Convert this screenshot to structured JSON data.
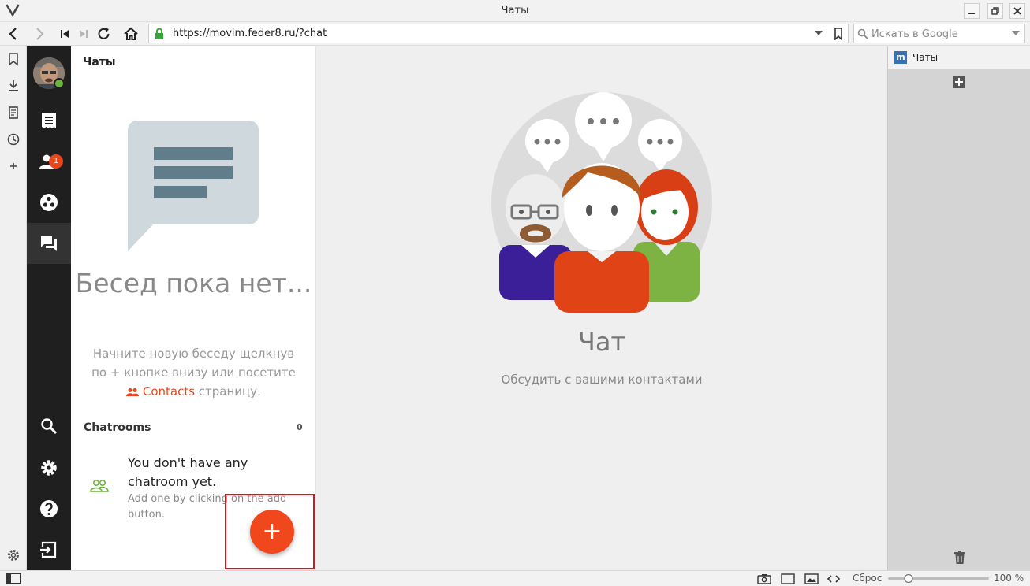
{
  "window": {
    "title": "Чаты"
  },
  "browser": {
    "url": "https://movim.feder8.ru/?chat",
    "search_placeholder": "Искать в Google",
    "zoom_reset_label": "Сброс",
    "zoom_level": "100 %"
  },
  "sidebar": {
    "contacts_badge": "1"
  },
  "chats_panel": {
    "header": "Чаты",
    "empty_title": "Бесед пока нет...",
    "empty_text_1": "Начните новую беседу щелкнув по + кнопке внизу или посетите",
    "contacts_link": "Contacts",
    "empty_text_2": " страницу.",
    "chatrooms_header": "Chatrooms",
    "chatrooms_count": "0",
    "no_chatroom_title": "You don't have any chatroom yet.",
    "no_chatroom_sub": "Add one by clicking on the add button.",
    "fab_label": "+"
  },
  "main": {
    "title": "Чат",
    "subtitle": "Обсудить с вашими контактами"
  },
  "web_panel": {
    "tab_title": "Чаты",
    "favicon_letter": "m"
  },
  "colors": {
    "accent": "#f1471d",
    "sidebar_bg": "#1f1f1f",
    "online": "#6db33f",
    "highlight_box": "#e0121a"
  }
}
